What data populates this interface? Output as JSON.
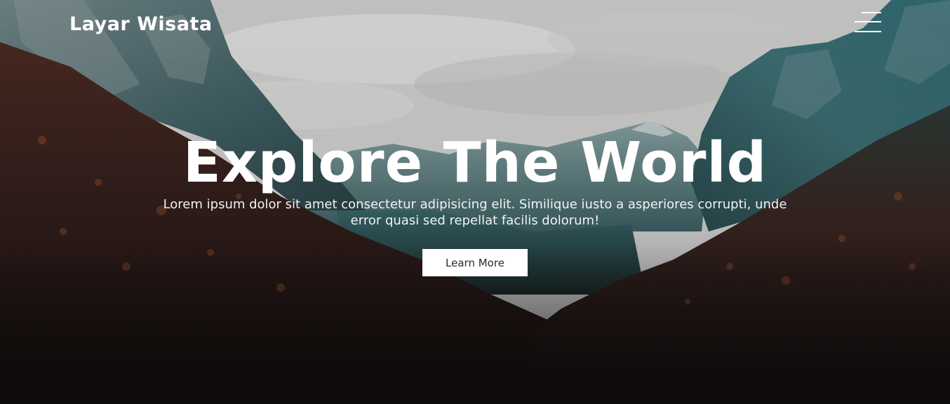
{
  "header": {
    "brand": "Layar Wisata",
    "menu_icon": "hamburger-menu-icon"
  },
  "hero": {
    "title": "Explore The World",
    "subtitle": "Lorem ipsum dolor sit amet consectetur adipisicing elit. Similique iusto a asperiores corrupti, unde error quasi sed repellat facilis dolorum!",
    "cta_label": "Learn More",
    "background": "mountain-valley-forest-photo"
  },
  "colors": {
    "text": "#ffffff",
    "button_bg": "#ffffff",
    "button_text": "#2b2b2b",
    "sky": "#d5d5d3",
    "mountain": "#2d5e66",
    "forest": "#3a1f1c",
    "bottom": "#141011"
  }
}
